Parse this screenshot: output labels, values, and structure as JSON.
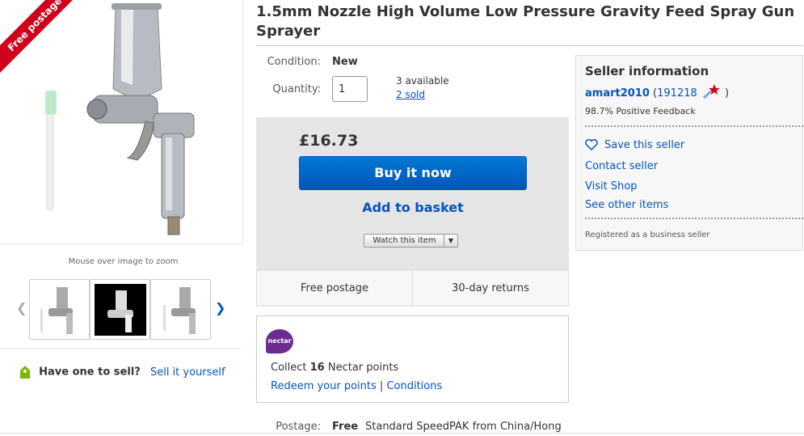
{
  "listing": {
    "title": "1.5mm Nozzle High Volume Low Pressure Gravity Feed Spray Gun Sprayer",
    "ribbon": "Free postage",
    "zoom_hint": "Mouse over image to zoom"
  },
  "sell": {
    "question": "Have one to sell?",
    "link": "Sell it yourself"
  },
  "details": {
    "condition_label": "Condition:",
    "condition_value": "New",
    "quantity_label": "Quantity:",
    "quantity_value": "1",
    "available": "3 available",
    "sold": "2 sold"
  },
  "buy": {
    "price": "£16.73",
    "buy_now": "Buy it now",
    "add_basket": "Add to basket",
    "watch": "Watch this item"
  },
  "perks": {
    "postage": "Free postage",
    "returns": "30-day returns"
  },
  "nectar": {
    "logo": "nectar",
    "collect_prefix": "Collect ",
    "points": "16",
    "collect_suffix": " Nectar points",
    "redeem": "Redeem your points",
    "separator": " | ",
    "conditions": "Conditions"
  },
  "postage": {
    "label": "Postage:",
    "value": "Free",
    "description": "Standard SpeedPAK from China/Hong"
  },
  "seller": {
    "heading": "Seller information",
    "username": "amart2010",
    "score_open": " (",
    "score": "191218",
    "score_close": " )",
    "feedback": "98.7% Positive Feedback",
    "save": "Save this seller",
    "contact": "Contact seller",
    "shop": "Visit Shop",
    "other": "See other items",
    "registered": "Registered as a business seller"
  },
  "colors": {
    "link": "#0654ba",
    "ribbon": "#d0021b",
    "nectar": "#6b2c91"
  }
}
